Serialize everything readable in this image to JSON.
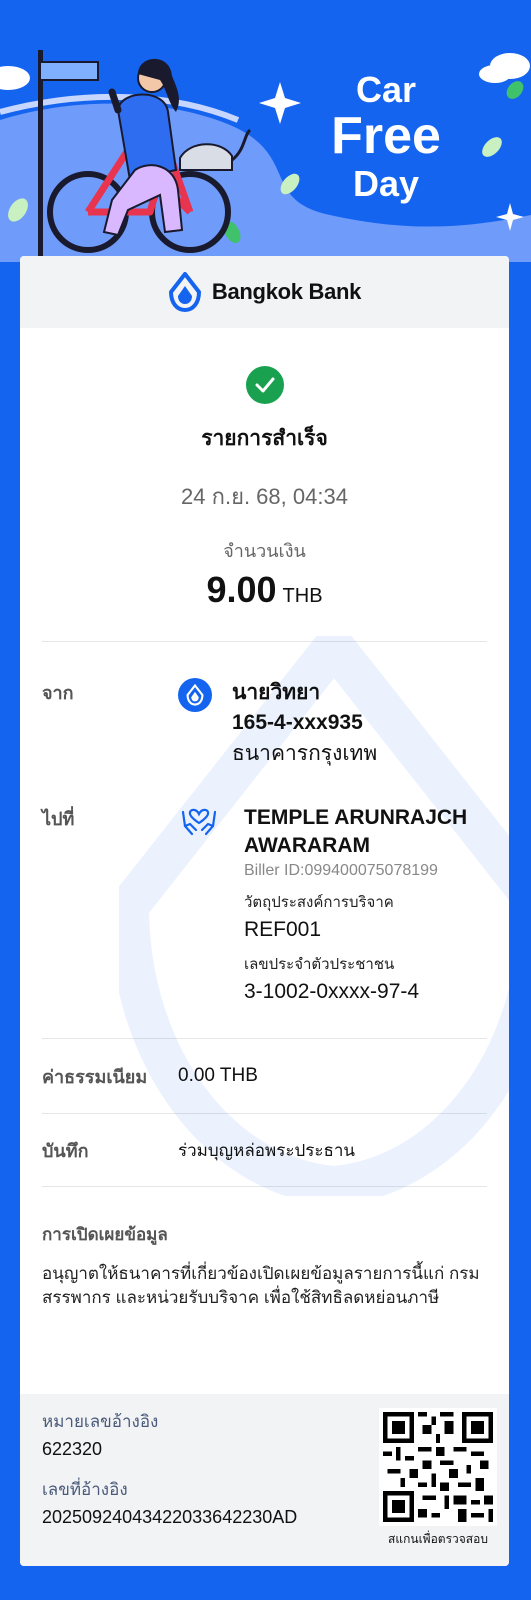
{
  "banner": {
    "title_line1": "Car",
    "title_line2": "Free",
    "title_line3": "Day"
  },
  "header": {
    "bank_name": "Bangkok Bank"
  },
  "status": {
    "text": "รายการสำเร็จ",
    "datetime": "24 ก.ย. 68, 04:34",
    "amount_label": "จำนวนเงิน",
    "amount": "9.00",
    "currency": "THB"
  },
  "from": {
    "label": "จาก",
    "name": "นายวิทยา",
    "account": "165-4-xxx935",
    "bank": "ธนาคารกรุงเทพ"
  },
  "to": {
    "label": "ไปที่",
    "name": "TEMPLE ARUNRAJCH AWARARAM",
    "biller_id": "Biller ID:099400075078199",
    "purpose_label": "วัตถุประสงค์การบริจาค",
    "purpose_value": "REF001",
    "citizen_label": "เลขประจำตัวประชาชน",
    "citizen_value": "3-1002-0xxxx-97-4"
  },
  "fee": {
    "label": "ค่าธรรมเนียม",
    "value": "0.00 THB"
  },
  "memo": {
    "label": "บันทึก",
    "value": "ร่วมบุญหล่อพระประธาน"
  },
  "disclosure": {
    "title": "การเปิดเผยข้อมูล",
    "body": "อนุญาตให้ธนาคารที่เกี่ยวข้องเปิดเผยข้อมูลรายการนี้แก่ กรมสรรพากร และหน่วยรับบริจาค เพื่อใช้สิทธิลดหย่อนภาษี"
  },
  "footer": {
    "ref_no_label": "หมายเลขอ้างอิง",
    "ref_no_value": "622320",
    "ref_id_label": "เลขที่อ้างอิง",
    "ref_id_value": "20250924043422033642230AD",
    "qr_caption": "สแกนเพื่อตรวจสอบ"
  },
  "colors": {
    "brand_blue": "#1464f0",
    "success_green": "#19a150"
  },
  "icons": {
    "logo": "bangkok-bank-lotus-icon",
    "success": "check-circle-icon",
    "donation": "hands-heart-icon"
  }
}
